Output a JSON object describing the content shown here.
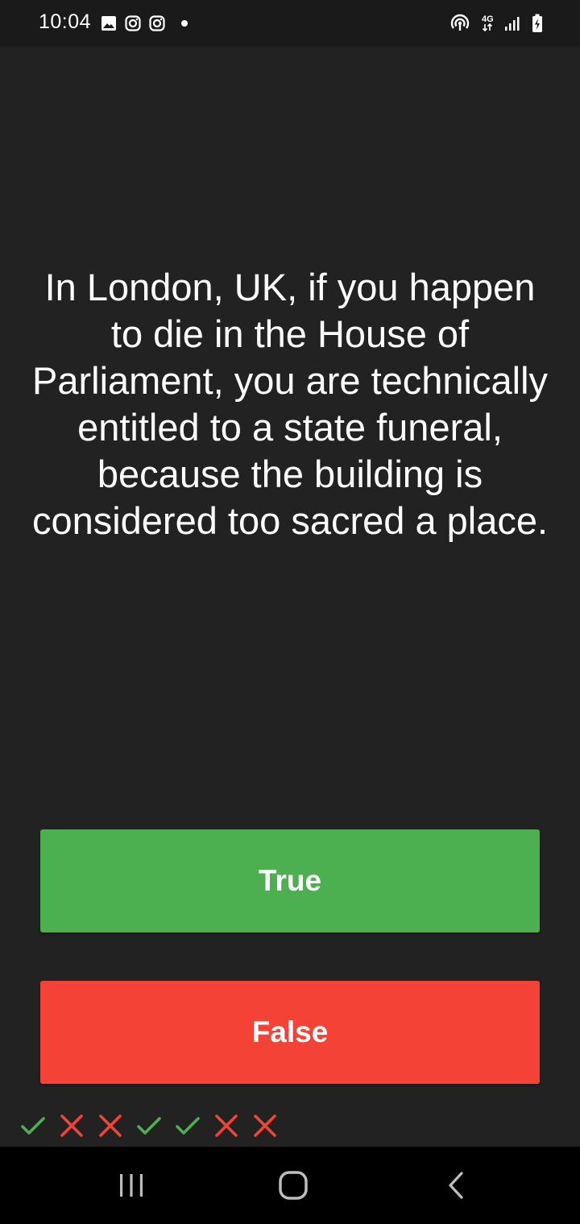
{
  "status_bar": {
    "time": "10:04",
    "network_label": "4G",
    "left_icons": [
      "gallery-icon",
      "instagram-icon",
      "instagram-icon",
      "dot-icon"
    ],
    "right_icons": [
      "hotspot-icon",
      "network-4g-icon",
      "signal-icon",
      "battery-charging-icon"
    ]
  },
  "question": {
    "text": "In London, UK, if you happen to die in the House of Parliament, you are technically entitled to a state funeral, because the building is considered too sacred a place."
  },
  "answers": {
    "true_label": "True",
    "false_label": "False"
  },
  "history": [
    "correct",
    "wrong",
    "wrong",
    "correct",
    "correct",
    "wrong",
    "wrong"
  ],
  "colors": {
    "background": "#222222",
    "true_button": "#4caf50",
    "false_button": "#f44336",
    "correct_mark": "#4caf50",
    "wrong_mark": "#f44336"
  },
  "nav_bar": {
    "buttons": [
      "recents-icon",
      "home-icon",
      "back-icon"
    ]
  }
}
